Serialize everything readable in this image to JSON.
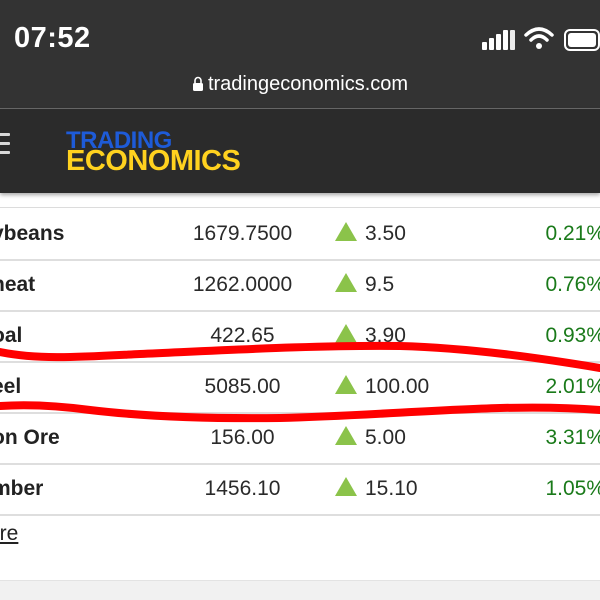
{
  "status_bar": {
    "time": "07:52",
    "icons": [
      "cellular-signal-icon",
      "wifi-icon",
      "battery-icon"
    ]
  },
  "browser": {
    "url": "tradingeconomics.com",
    "lock_icon": "lock-icon"
  },
  "header": {
    "menu_icon": "hamburger-menu-icon",
    "logo_line1": "TRADING",
    "logo_line2": "ECONOMICS"
  },
  "commodities": {
    "rows": [
      {
        "name": "ybeans",
        "price": "1679.7500",
        "change": "3.50",
        "pct": "0.21%"
      },
      {
        "name": "heat",
        "price": "1262.0000",
        "change": "9.5",
        "pct": "0.76%"
      },
      {
        "name": "oal",
        "price": "422.65",
        "change": "3.90",
        "pct": "0.93%"
      },
      {
        "name": "eel",
        "price": "5085.00",
        "change": "100.00",
        "pct": "2.01%"
      },
      {
        "name": "on Ore",
        "price": "156.00",
        "change": "5.00",
        "pct": "3.31%"
      },
      {
        "name": "mber",
        "price": "1456.10",
        "change": "15.10",
        "pct": "1.05%"
      }
    ],
    "more_link": "ore"
  },
  "colors": {
    "status_bg": "#333333",
    "header_bg": "#2b2b2b",
    "logo_blue": "#1e5bd8",
    "logo_yellow": "#ffd21f",
    "up_arrow": "#8bc34a",
    "positive_pct": "#1a7a1a",
    "marker_red": "#ff0000"
  }
}
